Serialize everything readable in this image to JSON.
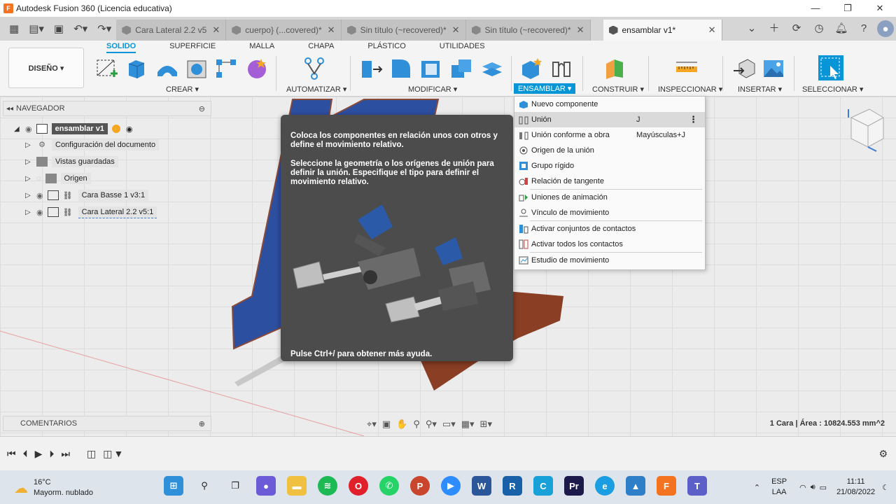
{
  "window": {
    "title": "Autodesk Fusion 360 (Licencia educativa)"
  },
  "tabs": [
    {
      "label": "Cara Lateral 2.2 v5"
    },
    {
      "label": "cuerpo} (...covered)*"
    },
    {
      "label": "Sin título (~recovered)*"
    },
    {
      "label": "Sin título (~recovered)*"
    },
    {
      "label": "ensamblar v1*"
    }
  ],
  "ribbon": {
    "workspace": "DISEÑO ▾",
    "tabs": [
      "SOLIDO",
      "SUPERFICIE",
      "MALLA",
      "CHAPA",
      "PLÁSTICO",
      "UTILIDADES"
    ],
    "groups": {
      "crear": "CREAR ▾",
      "automatizar": "AUTOMATIZAR ▾",
      "modificar": "MODIFICAR ▾",
      "ensamblar": "ENSAMBLAR ▾",
      "construir": "CONSTRUIR ▾",
      "inspeccionar": "INSPECCIONAR ▾",
      "insertar": "INSERTAR ▾",
      "seleccionar": "SELECCIONAR ▾"
    }
  },
  "browser": {
    "header": "NAVEGADOR",
    "root": "ensamblar v1",
    "items": [
      "Configuración del documento",
      "Vistas guardadas",
      "Origen",
      "Cara Basse 1 v3:1",
      "Cara Lateral 2.2 v5:1"
    ]
  },
  "comments": {
    "header": "COMENTARIOS"
  },
  "tooltip": {
    "p1": "Coloca los componentes en relación unos con otros y define el movimiento relativo.",
    "p2": "Seleccione la geometría o los orígenes de unión para definir la unión. Especifique el tipo para definir el movimiento relativo.",
    "help": "Pulse Ctrl+/ para obtener más ayuda."
  },
  "menu": {
    "items": [
      {
        "label": "Nuevo componente",
        "shortcut": ""
      },
      {
        "label": "Unión",
        "shortcut": "J"
      },
      {
        "label": "Unión conforme a obra",
        "shortcut": "Mayúsculas+J"
      },
      {
        "label": "Origen de la unión",
        "shortcut": ""
      },
      {
        "label": "Grupo rígido",
        "shortcut": ""
      },
      {
        "label": "Relación de tangente",
        "shortcut": ""
      },
      {
        "label": "Uniones de animación",
        "shortcut": ""
      },
      {
        "label": "Vínculo de movimiento",
        "shortcut": ""
      },
      {
        "label": "Activar conjuntos de contactos",
        "shortcut": ""
      },
      {
        "label": "Activar todos los contactos",
        "shortcut": ""
      },
      {
        "label": "Estudio de movimiento",
        "shortcut": ""
      }
    ]
  },
  "status": "1 Cara | Área : 10824.553 mm^2",
  "taskbar": {
    "temp": "16°C",
    "weather": "Mayorm. nublado",
    "lang1": "ESP",
    "lang2": "LAA",
    "time": "11:11",
    "date": "21/08/2022"
  },
  "colors": {
    "accent": "#0696d7",
    "fusion": "#f37321"
  }
}
